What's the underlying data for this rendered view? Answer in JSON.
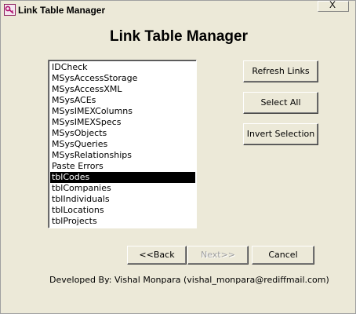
{
  "window": {
    "title": "Link Table Manager",
    "close_label": "X"
  },
  "heading": "Link Table Manager",
  "table_list": {
    "items": [
      {
        "label": "IDCheck",
        "selected": false
      },
      {
        "label": "MSysAccessStorage",
        "selected": false
      },
      {
        "label": "MSysAccessXML",
        "selected": false
      },
      {
        "label": "MSysACEs",
        "selected": false
      },
      {
        "label": "MSysIMEXColumns",
        "selected": false
      },
      {
        "label": "MSysIMEXSpecs",
        "selected": false
      },
      {
        "label": "MSysObjects",
        "selected": false
      },
      {
        "label": "MSysQueries",
        "selected": false
      },
      {
        "label": "MSysRelationships",
        "selected": false
      },
      {
        "label": "Paste Errors",
        "selected": false
      },
      {
        "label": "tblCodes",
        "selected": true
      },
      {
        "label": "tblCompanies",
        "selected": false
      },
      {
        "label": "tblIndividuals",
        "selected": false
      },
      {
        "label": "tblLocations",
        "selected": false
      },
      {
        "label": "tblProjects",
        "selected": false
      }
    ]
  },
  "actions": {
    "refresh_links": "Refresh Links",
    "select_all": "Select All",
    "invert_selection": "Invert Selection"
  },
  "navigation": {
    "back": "<<Back",
    "next": "Next>>",
    "next_enabled": false,
    "cancel": "Cancel"
  },
  "footer": "Developed By: Vishal Monpara (vishal_monpara@rediffmail.com)",
  "colors": {
    "window_bg": "#ece9d8",
    "selection_bg": "#000000",
    "selection_fg": "#ffffff",
    "disabled_text": "#a0a0a0"
  }
}
